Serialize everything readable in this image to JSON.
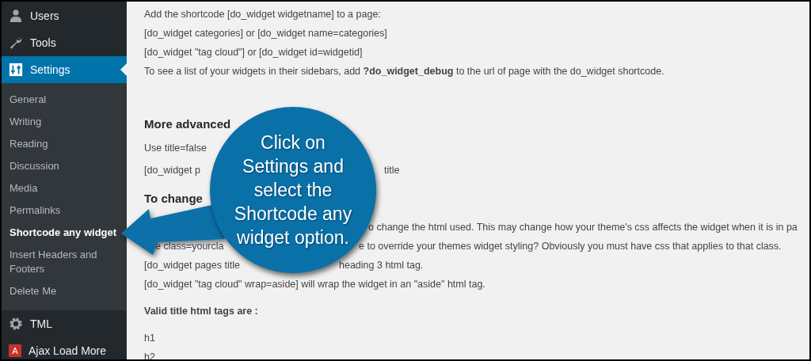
{
  "sidebar": {
    "top_items": [
      {
        "label": "Users",
        "kind": "users",
        "selected": false
      },
      {
        "label": "Tools",
        "kind": "tools",
        "selected": false
      },
      {
        "label": "Settings",
        "kind": "settings",
        "selected": true
      }
    ],
    "submenu": [
      {
        "label": "General",
        "selected": false
      },
      {
        "label": "Writing",
        "selected": false
      },
      {
        "label": "Reading",
        "selected": false
      },
      {
        "label": "Discussion",
        "selected": false
      },
      {
        "label": "Media",
        "selected": false
      },
      {
        "label": "Permalinks",
        "selected": false
      },
      {
        "label": "Shortcode any widget",
        "selected": true
      },
      {
        "label": "Insert Headers and Footers",
        "selected": false
      },
      {
        "label": "Delete Me",
        "selected": false
      }
    ],
    "bottom_items": [
      {
        "label": "TML",
        "kind": "gear"
      },
      {
        "label": "Ajax Load More",
        "kind": "letter",
        "badge": "A"
      }
    ]
  },
  "content": {
    "sections": [
      {
        "lines": [
          {
            "text": "Add the shortcode [do_widget widgetname] to a page:"
          },
          {
            "text": "[do_widget categories] or [do_widget name=categories]"
          },
          {
            "text": "[do_widget \"tag cloud\"] or [do_widget id=widgetid]"
          },
          {
            "text": "To see a list of your widgets in their sidebars, add **?do_widget_debug** to the url of page with the do_widget shortcode."
          }
        ]
      },
      {
        "heading": "More advanced",
        "lines": [
          {
            "text": "Use title=false"
          },
          {
            "text": "[do_widget p",
            "tail": "title"
          }
        ]
      },
      {
        "heading": "To change",
        "lines": [
          {
            "tail": "o change the html used. This may change how your theme's css affects the widget when it is in pa"
          },
          {
            "text": "e class=yourcla",
            "tail": "e to override your themes widget styling? Obviously you must have css that applies to that class."
          },
          {
            "text": "[do_widget pages title",
            "tail": "heading 3 html tag."
          },
          {
            "text": "[do_widget \"tag cloud\" wrap=aside] will wrap the widget in an \"aside\" html tag."
          }
        ]
      },
      {
        "label": "Valid title html tags are :",
        "lines": [
          {
            "text": "h1"
          },
          {
            "text": "h2"
          }
        ]
      }
    ]
  },
  "callout": {
    "lines": [
      "Click on",
      "Settings and",
      "select the",
      "Shortcode any",
      "widget option."
    ]
  }
}
